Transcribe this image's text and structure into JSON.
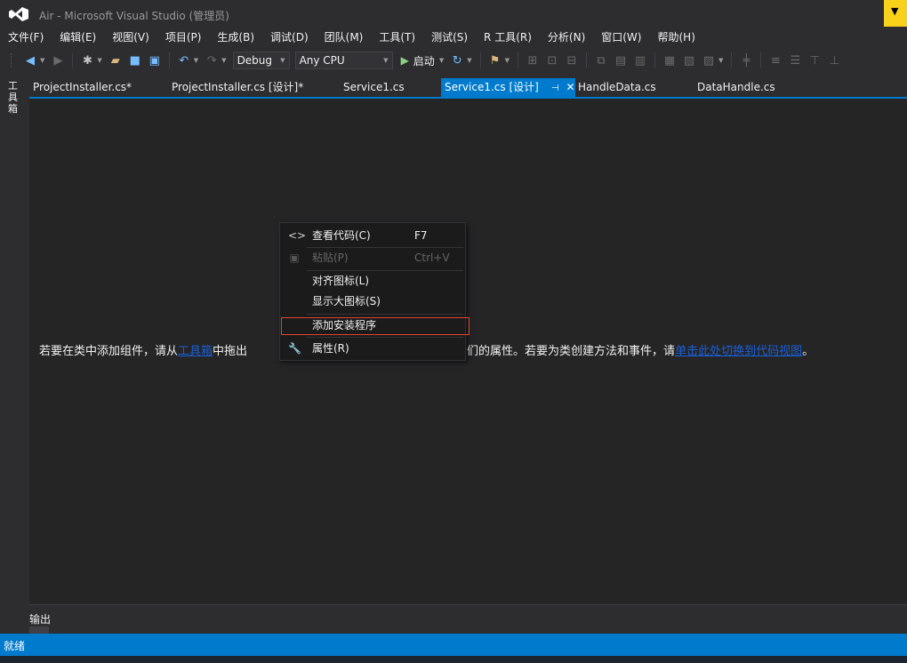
{
  "window": {
    "title": "Air - Microsoft Visual Studio (管理员)",
    "accent_color": "#f8d21a"
  },
  "menu": [
    "文件(F)",
    "编辑(E)",
    "视图(V)",
    "项目(P)",
    "生成(B)",
    "调试(D)",
    "团队(M)",
    "工具(T)",
    "测试(S)",
    "R 工具(R)",
    "分析(N)",
    "窗口(W)",
    "帮助(H)"
  ],
  "toolbar": {
    "configuration": "Debug",
    "platform": "Any CPU",
    "start_label": "启动"
  },
  "side_panel": {
    "toolbox_label": "工具箱"
  },
  "tabs": [
    {
      "label": "ProjectInstaller.cs*",
      "active": false
    },
    {
      "label": "ProjectInstaller.cs [设计]*",
      "active": false
    },
    {
      "label": "Service1.cs",
      "active": false
    },
    {
      "label": "Service1.cs [设计]",
      "active": true
    },
    {
      "label": "HandleData.cs",
      "active": false
    },
    {
      "label": "DataHandle.cs",
      "active": false
    }
  ],
  "designer": {
    "hint_before": "若要在类中添加组件，请从",
    "hint_link1": "工具箱",
    "hint_middle": "中拖出",
    "hint_after": "设置它们的属性。若要为类创建方法和事件，请",
    "hint_link2": "单击此处切换到代码视图",
    "hint_end": "。"
  },
  "context_menu": {
    "items": [
      {
        "icon": "code-icon",
        "label": "查看代码(C)",
        "shortcut": "F7",
        "enabled": true
      },
      {
        "icon": "paste-icon",
        "label": "粘贴(P)",
        "shortcut": "Ctrl+V",
        "enabled": false
      },
      {
        "icon": "",
        "label": "对齐图标(L)",
        "shortcut": "",
        "enabled": true
      },
      {
        "icon": "",
        "label": "显示大图标(S)",
        "shortcut": "",
        "enabled": true
      },
      {
        "icon": "",
        "label": "添加安装程序",
        "shortcut": "",
        "enabled": true,
        "highlighted": true
      },
      {
        "icon": "wrench-icon",
        "label": "属性(R)",
        "shortcut": "",
        "enabled": true
      }
    ],
    "highlight_color": "#e0452b"
  },
  "output_panel": {
    "label": "输出"
  },
  "status": {
    "text": "就绪",
    "color": "#007acc"
  }
}
